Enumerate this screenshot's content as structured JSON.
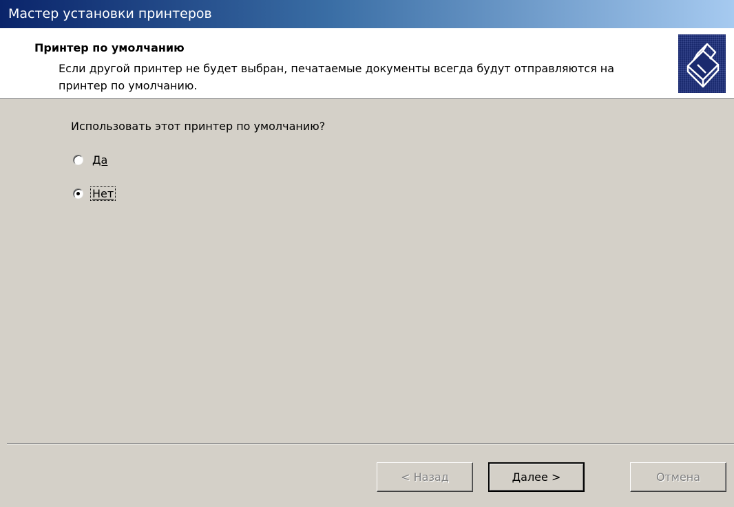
{
  "window": {
    "title": "Мастер установки принтеров"
  },
  "header": {
    "title": "Принтер по умолчанию",
    "subtitle": "Если другой принтер не будет выбран, печатаемые документы всегда будут отправляются на принтер по умолчанию.",
    "icon": "printer-wizard-icon"
  },
  "main": {
    "question": "Использовать этот принтер по умолчанию?",
    "options": [
      {
        "label": "Да",
        "selected": false
      },
      {
        "label": "Нет",
        "selected": true
      }
    ]
  },
  "buttons": {
    "back": "< Назад",
    "next": "Далее >",
    "cancel": "Отмена"
  }
}
